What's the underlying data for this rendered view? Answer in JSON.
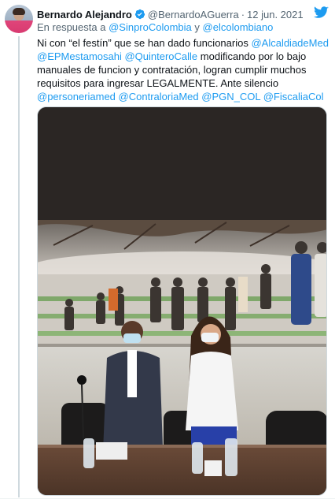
{
  "tweet": {
    "author_name": "Bernardo Alejandro",
    "handle": "@BernardoAGuerra",
    "separator": "·",
    "date": "12 jun. 2021",
    "reply_prefix": "En respuesta a",
    "reply_handle_1": "@SinproColombia",
    "reply_and": "y",
    "reply_handle_2": "@elcolombiano",
    "body": {
      "t1": "Ni con “el festín” que se han dado funcionarios ",
      "m1": "@AlcaldiadeMed",
      "m2": "@EPMestamosahi",
      "t2": " ",
      "m3": "@QuinteroCalle",
      "t3": " modificando por lo bajo manuales de funcion y contratación, logran cumplir muchos requisitos para ingresar LEGALMENTE. Ante silencio ",
      "m4": "@personeriamed",
      "t4": " ",
      "m5": "@ContraloriaMed",
      "t5": " ",
      "m6": "@PGN_COL",
      "t6": " ",
      "m7": "@FiscaliaCol"
    },
    "icons": {
      "verified": "verified-badge-icon",
      "logo": "twitter-bird-icon"
    },
    "colors": {
      "link": "#1d9bf0",
      "secondary_text": "#536471",
      "primary_text": "#0f1419"
    }
  }
}
